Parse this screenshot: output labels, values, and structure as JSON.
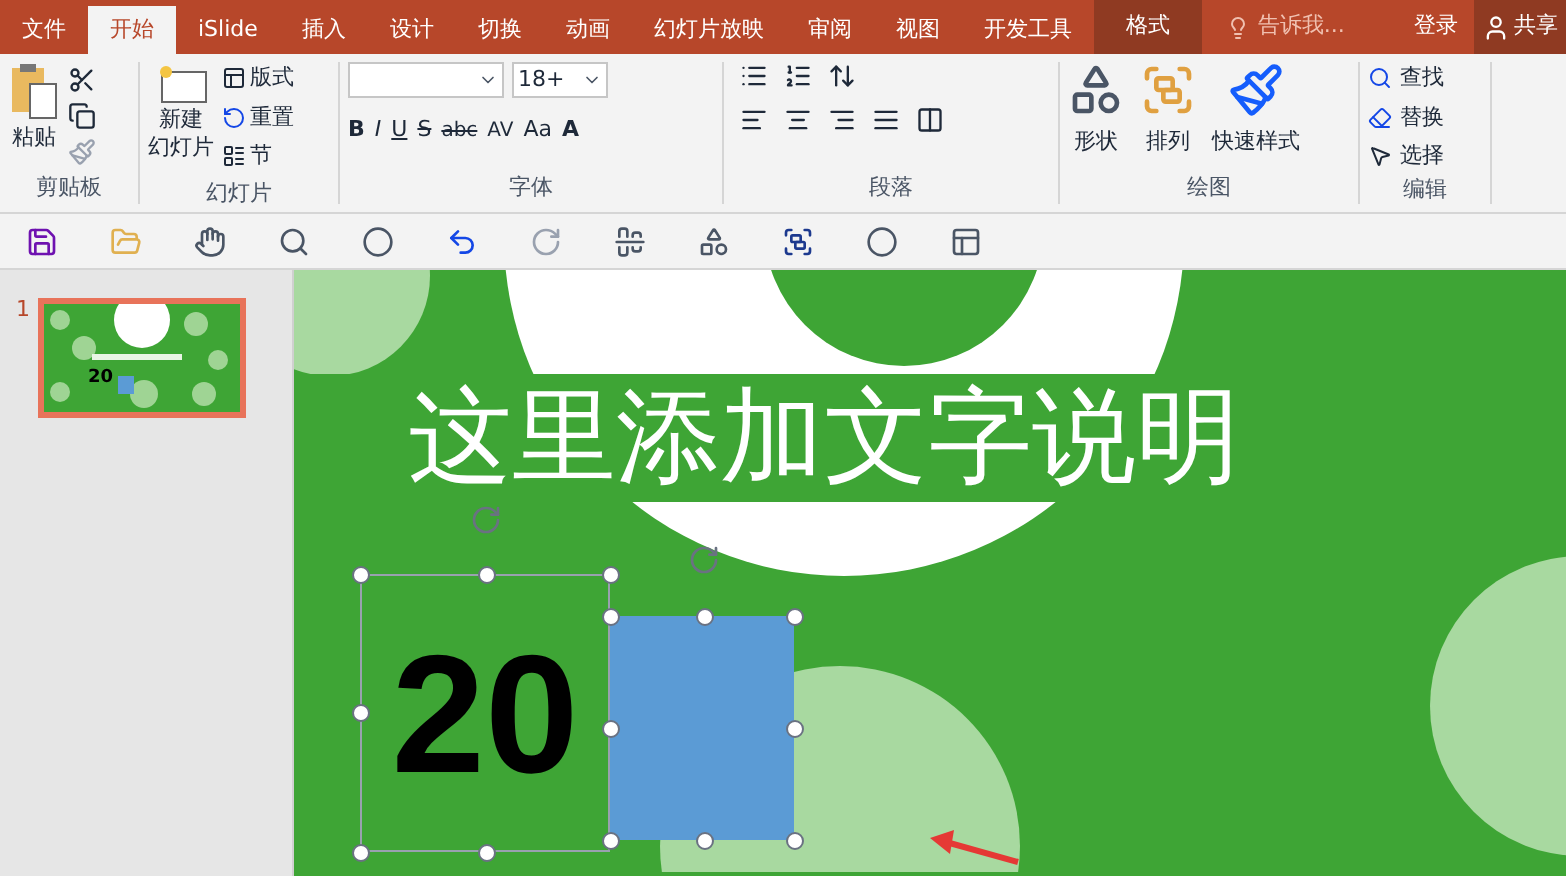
{
  "menu_tabs": [
    {
      "label": "文件",
      "selected": false,
      "kind": "normal"
    },
    {
      "label": "开始",
      "selected": true,
      "kind": "normal"
    },
    {
      "label": "iSlide",
      "selected": false,
      "kind": "normal"
    },
    {
      "label": "插入",
      "selected": false,
      "kind": "normal"
    },
    {
      "label": "设计",
      "selected": false,
      "kind": "normal"
    },
    {
      "label": "切换",
      "selected": false,
      "kind": "normal"
    },
    {
      "label": "动画",
      "selected": false,
      "kind": "normal"
    },
    {
      "label": "幻灯片放映",
      "selected": false,
      "kind": "normal"
    },
    {
      "label": "审阅",
      "selected": false,
      "kind": "normal"
    },
    {
      "label": "视图",
      "selected": false,
      "kind": "normal"
    },
    {
      "label": "开发工具",
      "selected": false,
      "kind": "normal"
    },
    {
      "label": "格式",
      "selected": false,
      "kind": "contextual"
    }
  ],
  "tell_me": {
    "placeholder": "告诉我..."
  },
  "sign_in": "登录",
  "share": "共享",
  "clipboard": {
    "paste": "粘贴",
    "label": "剪贴板"
  },
  "slides_group": {
    "new_slide": [
      "新建",
      "幻灯片"
    ],
    "layout": "版式",
    "reset": "重置",
    "section": "节",
    "label": "幻灯片"
  },
  "font_group": {
    "font_size": "18+",
    "buttons": [
      "B",
      "I",
      "U",
      "S",
      "abc",
      "AV",
      "Aa",
      "A"
    ],
    "label": "字体"
  },
  "paragraph_group": {
    "label": "段落"
  },
  "drawing_group": {
    "shapes": "形状",
    "arrange": "排列",
    "quick_styles": "快速样式",
    "label": "绘图"
  },
  "editing_group": {
    "find": "查找",
    "replace": "替换",
    "select": "选择",
    "label": "编辑"
  },
  "slide_panel": {
    "number": "1",
    "selected": true,
    "thumb_number": "20"
  },
  "slide": {
    "title": "这里添加文字说明",
    "number_text": "20"
  }
}
